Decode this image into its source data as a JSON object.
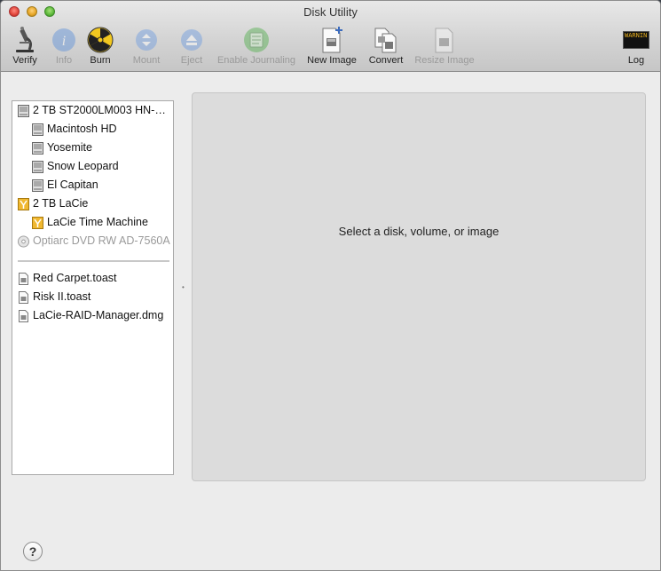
{
  "window": {
    "title": "Disk Utility"
  },
  "toolbar": {
    "verify": "Verify",
    "info": "Info",
    "burn": "Burn",
    "mount": "Mount",
    "eject": "Eject",
    "enable_journaling": "Enable Journaling",
    "new_image": "New Image",
    "convert": "Convert",
    "resize_image": "Resize Image",
    "log": "Log",
    "log_icon_text": "WARNIN"
  },
  "sidebar": {
    "devices": [
      {
        "label": "2 TB ST2000LM003 HN-…",
        "icon": "internal-disk-icon"
      },
      {
        "label": "Macintosh HD",
        "icon": "volume-icon"
      },
      {
        "label": "Yosemite",
        "icon": "volume-icon"
      },
      {
        "label": "Snow Leopard",
        "icon": "volume-icon"
      },
      {
        "label": "El Capitan",
        "icon": "volume-icon"
      },
      {
        "label": "2 TB LaCie",
        "icon": "external-disk-icon"
      },
      {
        "label": "LaCie Time Machine",
        "icon": "external-volume-icon"
      },
      {
        "label": "Optiarc DVD RW AD-7560A",
        "icon": "optical-drive-icon"
      }
    ],
    "images": [
      {
        "label": "Red Carpet.toast",
        "icon": "disk-image-icon"
      },
      {
        "label": "Risk II.toast",
        "icon": "disk-image-icon"
      },
      {
        "label": "LaCie-RAID-Manager.dmg",
        "icon": "disk-image-icon"
      }
    ]
  },
  "main": {
    "message": "Select a disk, volume, or image"
  },
  "footer": {
    "help": "?"
  }
}
